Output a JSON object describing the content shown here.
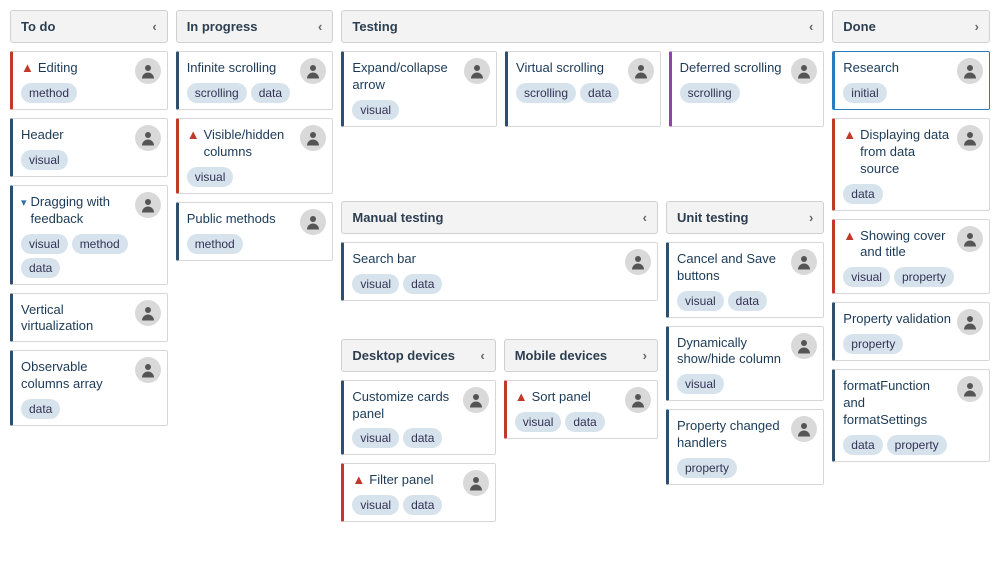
{
  "columns": {
    "todo": {
      "title": "To do",
      "arrow": "‹"
    },
    "inprogress": {
      "title": "In progress",
      "arrow": "‹"
    },
    "testing": {
      "title": "Testing",
      "arrow": "‹"
    },
    "done": {
      "title": "Done",
      "arrow": "›"
    }
  },
  "sub": {
    "manual": {
      "title": "Manual testing",
      "arrow": "‹"
    },
    "unit": {
      "title": "Unit testing",
      "arrow": "›"
    },
    "desktop": {
      "title": "Desktop devices",
      "arrow": "‹"
    },
    "mobile": {
      "title": "Mobile devices",
      "arrow": "›"
    }
  },
  "cards": {
    "editing": {
      "title": "Editing",
      "tags": [
        "method"
      ]
    },
    "header": {
      "title": "Header",
      "tags": [
        "visual"
      ]
    },
    "dragging": {
      "title": "Dragging with feedback",
      "tags": [
        "visual",
        "method",
        "data"
      ]
    },
    "vvirt": {
      "title": "Vertical virtualization",
      "tags": []
    },
    "obscols": {
      "title": "Observable columns array",
      "tags": [
        "data"
      ]
    },
    "infscroll": {
      "title": "Infinite scrolling",
      "tags": [
        "scrolling",
        "data"
      ]
    },
    "vishidden": {
      "title": "Visible/hidden columns",
      "tags": [
        "visual"
      ]
    },
    "pubmethods": {
      "title": "Public methods",
      "tags": [
        "method"
      ]
    },
    "expand": {
      "title": "Expand/collapse arrow",
      "tags": [
        "visual"
      ]
    },
    "virtscroll": {
      "title": "Virtual scrolling",
      "tags": [
        "scrolling",
        "data"
      ]
    },
    "defscroll": {
      "title": "Deferred scrolling",
      "tags": [
        "scrolling"
      ]
    },
    "searchbar": {
      "title": "Search bar",
      "tags": [
        "visual",
        "data"
      ]
    },
    "cancelsave": {
      "title": "Cancel and Save buttons",
      "tags": [
        "visual",
        "data"
      ]
    },
    "dynshow": {
      "title": "Dynamically show/hide column",
      "tags": [
        "visual"
      ]
    },
    "propchanged": {
      "title": "Property changed handlers",
      "tags": [
        "property"
      ]
    },
    "custcards": {
      "title": "Customize cards panel",
      "tags": [
        "visual",
        "data"
      ]
    },
    "filterpanel": {
      "title": "Filter panel",
      "tags": [
        "visual",
        "data"
      ]
    },
    "sortpanel": {
      "title": "Sort panel",
      "tags": [
        "visual",
        "data"
      ]
    },
    "research": {
      "title": "Research",
      "tags": [
        "initial"
      ]
    },
    "dispdata": {
      "title": "Displaying data from data source",
      "tags": [
        "data"
      ]
    },
    "showcover": {
      "title": "Showing cover and title",
      "tags": [
        "visual",
        "property"
      ]
    },
    "propval": {
      "title": "Property validation",
      "tags": [
        "property"
      ]
    },
    "formatfn": {
      "title": "formatFunction and formatSettings",
      "tags": [
        "data",
        "property"
      ]
    }
  }
}
